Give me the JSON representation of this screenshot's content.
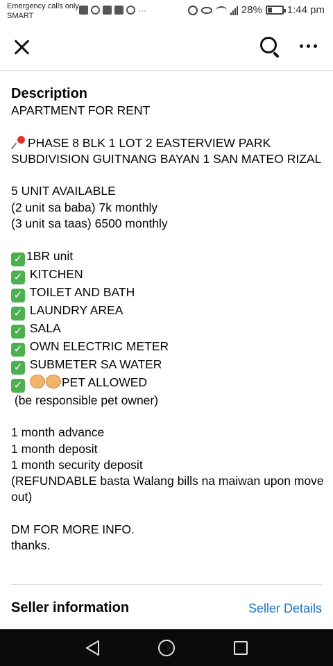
{
  "status_bar": {
    "carrier_line1": "Emergency calls only",
    "carrier_line2": "SMART",
    "battery_percent": "28%",
    "battery_level": 0.28,
    "time": "1:44 pm"
  },
  "app_bar": {
    "close_icon": "close-icon",
    "search_icon": "search-icon",
    "more_icon": "more-options-icon"
  },
  "description": {
    "title": "Description",
    "lines": [
      "APARTMENT FOR RENT",
      "",
      "PHASE 8 BLK 1 LOT 2 EASTERVIEW PARK SUBDIVISION GUITNANG BAYAN 1 SAN MATEO RIZAL",
      "",
      "5 UNIT AVAILABLE",
      "(2 unit sa baba) 7k monthly",
      "(3 unit sa taas) 6500 monthly",
      "",
      "1BR unit",
      " KITCHEN",
      " TOILET AND BATH",
      " LAUNDRY AREA",
      " SALA",
      " OWN ELECTRIC METER",
      " SUBMETER SA WATER",
      "PET ALLOWED",
      " (be responsible pet owner)",
      "",
      "1 month advance",
      "1 month deposit",
      "1 month security deposit",
      "(REFUNDABLE basta Walang bills na maiwan upon move out)",
      "",
      "DM FOR MORE INFO.",
      "thanks."
    ]
  },
  "seller": {
    "title": "Seller information",
    "link": "Seller Details"
  },
  "colors": {
    "link": "#1a73c9",
    "text": "#050505",
    "navbar": "#0b0b0b"
  }
}
